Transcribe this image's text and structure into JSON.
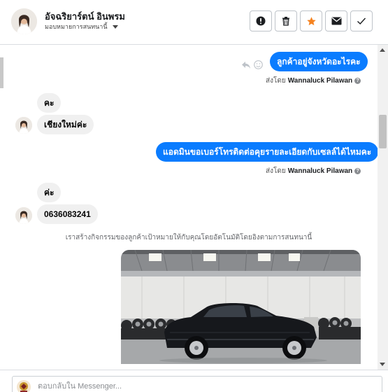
{
  "header": {
    "contact_name": "อัจฉริยาร์ตน์ อินพรม",
    "assign_label": "มอบหมายการสนทนานี้",
    "buttons": [
      {
        "icon": "exclamation-icon"
      },
      {
        "icon": "trash-icon"
      },
      {
        "icon": "star-icon",
        "color": "#f5821f"
      },
      {
        "icon": "envelope-icon"
      },
      {
        "icon": "check-icon"
      }
    ]
  },
  "messages": [
    {
      "direction": "out",
      "text": "ลูกค้าอยู่จังหวัดอะไรคะ",
      "sent_by_prefix": "ส่งโดย",
      "sent_by_name": "Wannaluck Pilawan"
    },
    {
      "direction": "in",
      "text": "คะ"
    },
    {
      "direction": "in",
      "text": "เชียงใหม่ค่ะ"
    },
    {
      "direction": "out",
      "text": "แอดมินขอเบอร์โทรติดต่อคุยรายละเอียดกับเซลล์ได้ไหมคะ",
      "sent_by_prefix": "ส่งโดย",
      "sent_by_name": "Wannaluck Pilawan"
    },
    {
      "direction": "in",
      "text": "ค่ะ"
    },
    {
      "direction": "in",
      "text": "0636083241"
    }
  ],
  "notice": "เราสร้างกิจกรรมของลูกค้าเป้าหมายให้กับคุณโดยอัตโนมัติโดยอิงตามการสนทนานี้",
  "composer": {
    "placeholder": "ตอบกลับใน Messenger..."
  },
  "colors": {
    "outgoing_bubble": "#0a7cff",
    "incoming_bubble": "#f0f0f0",
    "star": "#f5821f"
  }
}
